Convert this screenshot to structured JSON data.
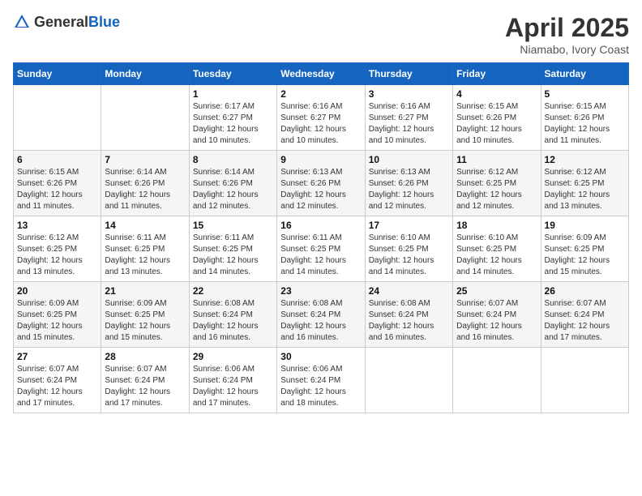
{
  "header": {
    "logo_general": "General",
    "logo_blue": "Blue",
    "month_title": "April 2025",
    "subtitle": "Niamabo, Ivory Coast"
  },
  "weekdays": [
    "Sunday",
    "Monday",
    "Tuesday",
    "Wednesday",
    "Thursday",
    "Friday",
    "Saturday"
  ],
  "weeks": [
    [
      {
        "day": "",
        "info": ""
      },
      {
        "day": "",
        "info": ""
      },
      {
        "day": "1",
        "info": "Sunrise: 6:17 AM\nSunset: 6:27 PM\nDaylight: 12 hours and 10 minutes."
      },
      {
        "day": "2",
        "info": "Sunrise: 6:16 AM\nSunset: 6:27 PM\nDaylight: 12 hours and 10 minutes."
      },
      {
        "day": "3",
        "info": "Sunrise: 6:16 AM\nSunset: 6:27 PM\nDaylight: 12 hours and 10 minutes."
      },
      {
        "day": "4",
        "info": "Sunrise: 6:15 AM\nSunset: 6:26 PM\nDaylight: 12 hours and 10 minutes."
      },
      {
        "day": "5",
        "info": "Sunrise: 6:15 AM\nSunset: 6:26 PM\nDaylight: 12 hours and 11 minutes."
      }
    ],
    [
      {
        "day": "6",
        "info": "Sunrise: 6:15 AM\nSunset: 6:26 PM\nDaylight: 12 hours and 11 minutes."
      },
      {
        "day": "7",
        "info": "Sunrise: 6:14 AM\nSunset: 6:26 PM\nDaylight: 12 hours and 11 minutes."
      },
      {
        "day": "8",
        "info": "Sunrise: 6:14 AM\nSunset: 6:26 PM\nDaylight: 12 hours and 12 minutes."
      },
      {
        "day": "9",
        "info": "Sunrise: 6:13 AM\nSunset: 6:26 PM\nDaylight: 12 hours and 12 minutes."
      },
      {
        "day": "10",
        "info": "Sunrise: 6:13 AM\nSunset: 6:26 PM\nDaylight: 12 hours and 12 minutes."
      },
      {
        "day": "11",
        "info": "Sunrise: 6:12 AM\nSunset: 6:25 PM\nDaylight: 12 hours and 12 minutes."
      },
      {
        "day": "12",
        "info": "Sunrise: 6:12 AM\nSunset: 6:25 PM\nDaylight: 12 hours and 13 minutes."
      }
    ],
    [
      {
        "day": "13",
        "info": "Sunrise: 6:12 AM\nSunset: 6:25 PM\nDaylight: 12 hours and 13 minutes."
      },
      {
        "day": "14",
        "info": "Sunrise: 6:11 AM\nSunset: 6:25 PM\nDaylight: 12 hours and 13 minutes."
      },
      {
        "day": "15",
        "info": "Sunrise: 6:11 AM\nSunset: 6:25 PM\nDaylight: 12 hours and 14 minutes."
      },
      {
        "day": "16",
        "info": "Sunrise: 6:11 AM\nSunset: 6:25 PM\nDaylight: 12 hours and 14 minutes."
      },
      {
        "day": "17",
        "info": "Sunrise: 6:10 AM\nSunset: 6:25 PM\nDaylight: 12 hours and 14 minutes."
      },
      {
        "day": "18",
        "info": "Sunrise: 6:10 AM\nSunset: 6:25 PM\nDaylight: 12 hours and 14 minutes."
      },
      {
        "day": "19",
        "info": "Sunrise: 6:09 AM\nSunset: 6:25 PM\nDaylight: 12 hours and 15 minutes."
      }
    ],
    [
      {
        "day": "20",
        "info": "Sunrise: 6:09 AM\nSunset: 6:25 PM\nDaylight: 12 hours and 15 minutes."
      },
      {
        "day": "21",
        "info": "Sunrise: 6:09 AM\nSunset: 6:25 PM\nDaylight: 12 hours and 15 minutes."
      },
      {
        "day": "22",
        "info": "Sunrise: 6:08 AM\nSunset: 6:24 PM\nDaylight: 12 hours and 16 minutes."
      },
      {
        "day": "23",
        "info": "Sunrise: 6:08 AM\nSunset: 6:24 PM\nDaylight: 12 hours and 16 minutes."
      },
      {
        "day": "24",
        "info": "Sunrise: 6:08 AM\nSunset: 6:24 PM\nDaylight: 12 hours and 16 minutes."
      },
      {
        "day": "25",
        "info": "Sunrise: 6:07 AM\nSunset: 6:24 PM\nDaylight: 12 hours and 16 minutes."
      },
      {
        "day": "26",
        "info": "Sunrise: 6:07 AM\nSunset: 6:24 PM\nDaylight: 12 hours and 17 minutes."
      }
    ],
    [
      {
        "day": "27",
        "info": "Sunrise: 6:07 AM\nSunset: 6:24 PM\nDaylight: 12 hours and 17 minutes."
      },
      {
        "day": "28",
        "info": "Sunrise: 6:07 AM\nSunset: 6:24 PM\nDaylight: 12 hours and 17 minutes."
      },
      {
        "day": "29",
        "info": "Sunrise: 6:06 AM\nSunset: 6:24 PM\nDaylight: 12 hours and 17 minutes."
      },
      {
        "day": "30",
        "info": "Sunrise: 6:06 AM\nSunset: 6:24 PM\nDaylight: 12 hours and 18 minutes."
      },
      {
        "day": "",
        "info": ""
      },
      {
        "day": "",
        "info": ""
      },
      {
        "day": "",
        "info": ""
      }
    ]
  ]
}
